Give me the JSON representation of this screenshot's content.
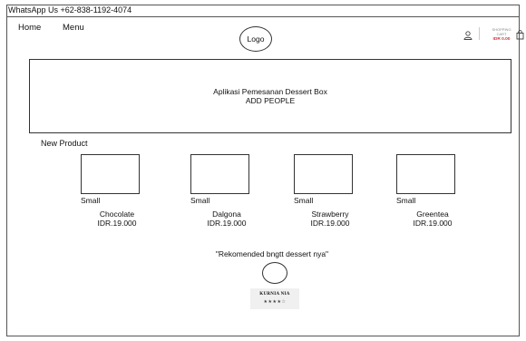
{
  "topbar": {
    "contact": "WhatsApp Us +62-838-1192-4074"
  },
  "nav": {
    "home": "Home",
    "menu": "Menu"
  },
  "logo": "Logo",
  "cart": {
    "label": "SHOPPING CART",
    "total": "IDR 0.00"
  },
  "banner": {
    "line1": "Aplikasi Pemesanan Dessert Box",
    "line2": "ADD PEOPLE"
  },
  "section_title": "New Product",
  "products": [
    {
      "size": "Small",
      "name": "Chocolate",
      "price": "IDR.19.000"
    },
    {
      "size": "Small",
      "name": "Dalgona",
      "price": "IDR.19.000"
    },
    {
      "size": "Small",
      "name": "Strawberry",
      "price": "IDR.19.000"
    },
    {
      "size": "Small",
      "name": "Greentea",
      "price": "IDR.19.000"
    }
  ],
  "testimonial": {
    "quote": "\"Rekomended bngtt dessert nya\"",
    "name": "KURNIA NIA",
    "stars": "★★★★☆",
    "rating": 4
  }
}
